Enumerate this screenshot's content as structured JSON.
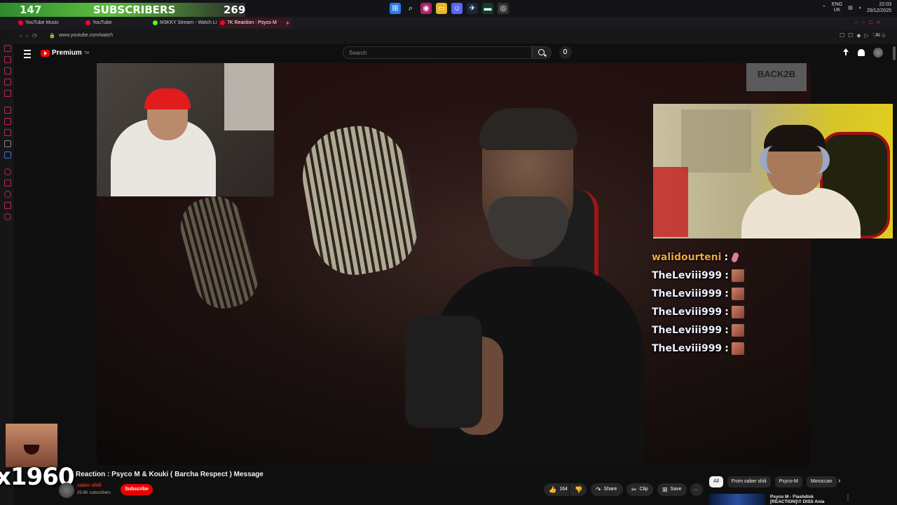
{
  "stream_overlay": {
    "subscriber_count": "147",
    "subscriber_label": "SUBSCRIBERS",
    "subscriber_goal": "269",
    "counter_text": "x1960"
  },
  "taskbar": {
    "icons": [
      "windows-start-icon",
      "search-icon",
      "app-icon",
      "folder-icon",
      "discord-icon",
      "steam-icon",
      "terminal-icon",
      "obs-icon"
    ],
    "tray": {
      "lang": "ENG",
      "region": "UK",
      "time": "22:03",
      "date": "29/12/2025"
    }
  },
  "browser": {
    "tabs": [
      {
        "label": "YouTube Music",
        "color": "#ff0033"
      },
      {
        "label": "YouTube",
        "color": "#ff0033"
      },
      {
        "label": "M3KKY Stream - Watch Li",
        "color": "#53fc18"
      },
      {
        "label": "7K Reaction : Psyco M",
        "color": "#ff0033",
        "active": true
      }
    ],
    "add_tab": "+",
    "url": "www.youtube.com/watch",
    "ai_label": "AI"
  },
  "youtube": {
    "logo_text": "Premium",
    "logo_sup": "TM",
    "search_placeholder": "Search"
  },
  "chat": [
    {
      "user": "walidourteni",
      "separator": ":",
      "emote": "pink",
      "gold": true
    },
    {
      "user": "TheLeviii999",
      "separator": ":",
      "emote": "face",
      "gold": false
    },
    {
      "user": "TheLeviii999",
      "separator": ":",
      "emote": "face",
      "gold": false
    },
    {
      "user": "TheLeviii999",
      "separator": ":",
      "emote": "face",
      "gold": false
    },
    {
      "user": "TheLeviii999",
      "separator": ":",
      "emote": "face",
      "gold": false
    },
    {
      "user": "TheLeviii999",
      "separator": ":",
      "emote": "face",
      "gold": false
    }
  ],
  "video": {
    "title": "K Reaction : Psyco M & Kouki ( Barcha Respect ) Message",
    "graffiti": "BACK2B",
    "channel_name": "saber shili",
    "channel_subs": "25.6K subscribers",
    "subscribe_label": "Subscribe",
    "likes": "164",
    "share_label": "Share",
    "clip_label": "Clip",
    "save_label": "Save",
    "more_label": "..."
  },
  "recommendations": {
    "chips": [
      "All",
      "From saber shili",
      "Psyco-M",
      "Moroccan"
    ],
    "next_arrow": "›",
    "first_title_line1": "Psyco M - Flashdisk",
    "first_title_line2": "[REACTION]!!! DISS Ania"
  }
}
